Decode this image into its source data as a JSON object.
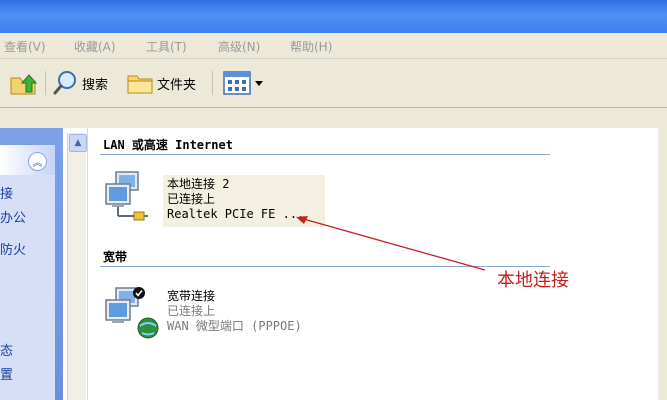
{
  "menu": {
    "view": "查看(V)",
    "favorites": "收藏(A)",
    "tools": "工具(T)",
    "advanced": "高级(N)",
    "help": "帮助(H)"
  },
  "toolbar": {
    "search_label": "搜索",
    "folders_label": "文件夹"
  },
  "left_panel": {
    "items": [
      "接",
      "办公",
      "防火",
      "态",
      "置"
    ]
  },
  "groups": [
    {
      "title": "LAN 或高速 Internet",
      "items": [
        {
          "name": "本地连接 2",
          "status": "已连接上",
          "device": "Realtek PCIe FE ..."
        }
      ]
    },
    {
      "title": "宽带",
      "items": [
        {
          "name": "宽带连接",
          "status": "已连接上",
          "device": "WAN 微型端口 (PPPOE)"
        }
      ]
    }
  ],
  "annotation": {
    "label": "本地连接",
    "color": "#c81e1e"
  },
  "colors": {
    "titlebar": "#3b7ff0",
    "menubar_bg": "#ece9d8",
    "group_line": "#8fa7d8"
  }
}
